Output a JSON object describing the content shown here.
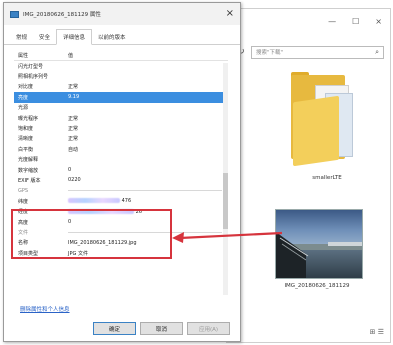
{
  "dialog": {
    "title": "IMG_20180626_181129 属性",
    "close_glyph": "×",
    "tabs": [
      {
        "label": "常规",
        "active": false
      },
      {
        "label": "安全",
        "active": false
      },
      {
        "label": "详细信息",
        "active": true
      },
      {
        "label": "以前的版本",
        "active": false
      }
    ],
    "column_headers": [
      "属性",
      "值"
    ],
    "rows": [
      {
        "key": "闪光灯型号",
        "value": ""
      },
      {
        "key": "照相机序列号",
        "value": ""
      },
      {
        "key": "对比度",
        "value": "正常"
      },
      {
        "key": "亮度",
        "value": "9.19",
        "selected": true
      },
      {
        "key": "光源",
        "value": ""
      },
      {
        "key": "曝光程序",
        "value": "正常"
      },
      {
        "key": "饱和度",
        "value": "正常"
      },
      {
        "key": "清晰度",
        "value": "正常"
      },
      {
        "key": "白平衡",
        "value": "自动"
      },
      {
        "key": "光度解释",
        "value": ""
      },
      {
        "key": "数字缩放",
        "value": "0"
      },
      {
        "key": "EXIF 版本",
        "value": "0220"
      }
    ],
    "gps_group": "GPS",
    "gps_rows": [
      {
        "key": "纬度",
        "value_suffix": "476"
      },
      {
        "key": "经度",
        "value_suffix": "26"
      },
      {
        "key": "高度",
        "value": "0"
      }
    ],
    "file_group": "文件",
    "file_rows": [
      {
        "key": "名称",
        "value": "IMG_20180626_181129.jpg"
      },
      {
        "key": "项目类型",
        "value": "JPG 文件"
      }
    ],
    "remove_link": "删除属性和个人信息",
    "buttons": {
      "ok": "确定",
      "cancel": "取消",
      "apply": "应用(A)"
    }
  },
  "explorer": {
    "window_controls": [
      "—",
      "☐",
      "×"
    ],
    "refresh_glyph": "↻",
    "search_placeholder": "搜索\"下载\"",
    "folder_label": "smallerLTE",
    "image_label": "IMG_20180626_181129",
    "status_icons": "⊞ ☰"
  },
  "colors": {
    "selection": "#3b8ee0",
    "highlight_box": "#d6343d",
    "arrow": "#d6343d",
    "folder": "#e7b93f"
  }
}
